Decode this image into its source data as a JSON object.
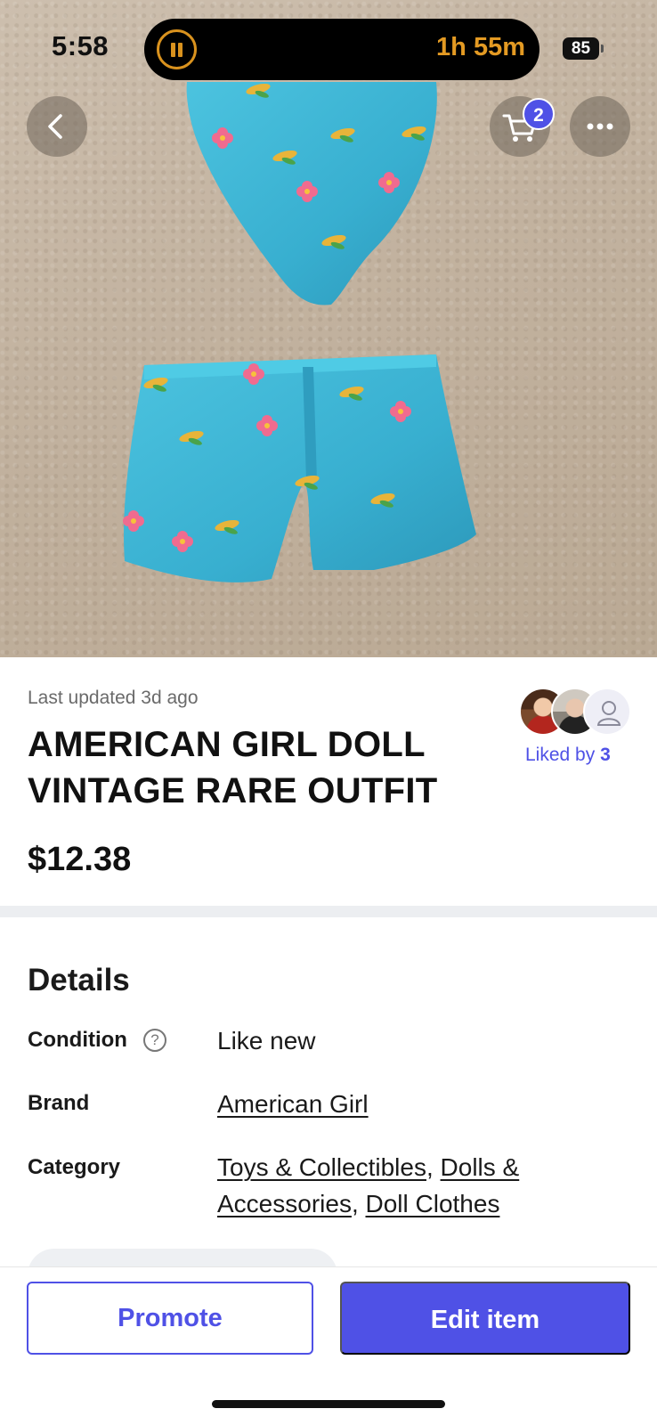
{
  "status_bar": {
    "time": "5:58",
    "timer": "1h 55m",
    "battery": "85"
  },
  "nav": {
    "cart_count": "2"
  },
  "listing": {
    "last_updated": "Last updated 3d ago",
    "title": "AMERICAN GIRL DOLL VINTAGE RARE OUTFIT",
    "price": "$12.38",
    "liked_by_label": "Liked by",
    "liked_by_count": "3"
  },
  "details": {
    "heading": "Details",
    "condition_label": "Condition",
    "condition_value": "Like new",
    "brand_label": "Brand",
    "brand_value": "American Girl",
    "category_label": "Category",
    "category_values": [
      "Toys & Collectibles",
      "Dolls & Accessories",
      "Doll Clothes"
    ],
    "help_glyph": "?"
  },
  "actions": {
    "promote": "Promote",
    "edit": "Edit item"
  },
  "colors": {
    "accent": "#4f51e6",
    "fabric": "#3fb7d6",
    "carpet": "#c4b4a1",
    "timer": "#e39a23"
  },
  "icons": [
    "pause-icon",
    "back-chevron-icon",
    "cart-icon",
    "more-icon",
    "help-icon",
    "person-icon"
  ]
}
